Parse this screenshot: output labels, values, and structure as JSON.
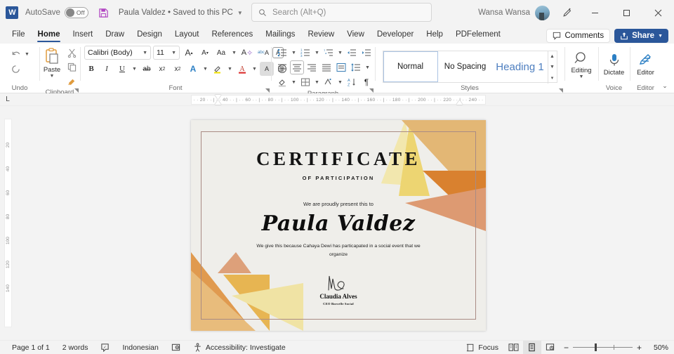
{
  "titlebar": {
    "app_logo": "word-logo",
    "autosave_label": "AutoSave",
    "autosave_state": "Off",
    "save_icon": "save-icon",
    "document_name": "Paula Valdez • Saved to this PC",
    "search_placeholder": "Search (Alt+Q)",
    "user_name": "Wansa Wansa",
    "pen_icon": "pen-sparkle-icon",
    "minimize": "minimize-icon",
    "restore": "restore-icon",
    "close": "close-icon"
  },
  "tabs": [
    {
      "label": "File",
      "active": false
    },
    {
      "label": "Home",
      "active": true
    },
    {
      "label": "Insert",
      "active": false
    },
    {
      "label": "Draw",
      "active": false
    },
    {
      "label": "Design",
      "active": false
    },
    {
      "label": "Layout",
      "active": false
    },
    {
      "label": "References",
      "active": false
    },
    {
      "label": "Mailings",
      "active": false
    },
    {
      "label": "Review",
      "active": false
    },
    {
      "label": "View",
      "active": false
    },
    {
      "label": "Developer",
      "active": false
    },
    {
      "label": "Help",
      "active": false
    },
    {
      "label": "PDFelement",
      "active": false
    }
  ],
  "tabbar_actions": {
    "comments_label": "Comments",
    "share_label": "Share"
  },
  "ribbon": {
    "groups": [
      {
        "name": "Undo",
        "label": "Undo"
      },
      {
        "name": "Clipboard",
        "label": "Clipboard",
        "paste_label": "Paste"
      },
      {
        "name": "Font",
        "label": "Font",
        "font_name": "Calibri (Body)",
        "font_size": "11"
      },
      {
        "name": "Paragraph",
        "label": "Paragraph"
      },
      {
        "name": "Styles",
        "label": "Styles"
      },
      {
        "name": "Voice",
        "label": "Voice",
        "button_label": "Dictate"
      },
      {
        "name": "Editor",
        "label": "Editor",
        "button_label": "Editor"
      }
    ],
    "editing_label": "Editing",
    "styles": [
      {
        "label": "Normal",
        "selected": true
      },
      {
        "label": "No Spacing",
        "selected": false
      },
      {
        "label": "Heading 1",
        "selected": false
      }
    ]
  },
  "ruler": {
    "horizontal_ticks": "· · | · · · | · · · | · · 20 · · | · · 40 · · | · · 60 · · | · · 80 · · | · · 100 · · | · · 120 · · | · · 140 · · | · · 160 · · | · · 180 · · | · · 200 · · | · · 220 · · | · · 240 · · | · · · · | · · · · |",
    "vertical_ticks": [
      "20",
      "40",
      "60",
      "80",
      "100",
      "120",
      "140"
    ],
    "tab_selector": "L"
  },
  "document": {
    "title": "CERTIFICATE",
    "subtitle": "OF PARTICIPATION",
    "presented_line": "We are proudly present this to",
    "recipient": "Paula Valdez",
    "description": "We give this because Cahaya Dewi has particapated in a social event that we organize",
    "signer_name": "Claudia Alves",
    "signer_role": "CEO Borcelle Social",
    "colors": {
      "background": "#efeeea",
      "border": "#a98b84",
      "accent_yellow": "#efd985",
      "accent_light_yellow": "#f1e2a0",
      "accent_orange": "#e09a4f",
      "accent_deep_orange": "#d97e37",
      "accent_salmon": "#dd9a72",
      "accent_tan": "#e6b874"
    }
  },
  "statusbar": {
    "page": "Page 1 of 1",
    "words": "2 words",
    "proofing_icon": "proofing-icon",
    "language": "Indonesian",
    "dictation_icon": "dictation-status-icon",
    "accessibility": "Accessibility: Investigate",
    "focus_label": "Focus",
    "view_read": "read-mode-icon",
    "view_print": "print-layout-icon",
    "view_web": "web-layout-icon",
    "zoom_out": "−",
    "zoom_in": "+",
    "zoom_level": "50%"
  }
}
